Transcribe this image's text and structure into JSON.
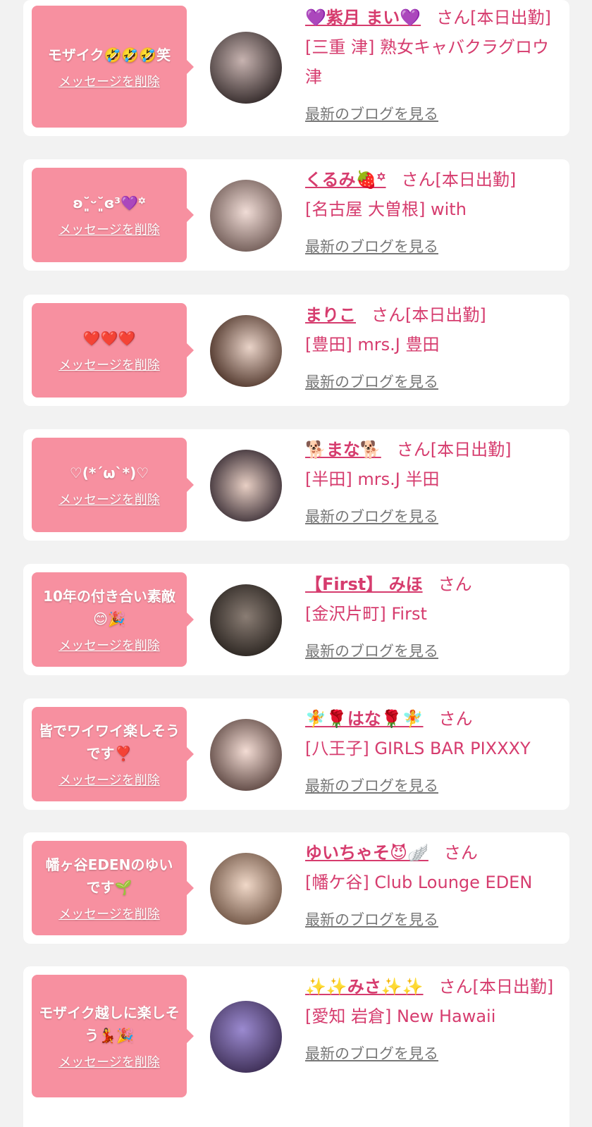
{
  "common": {
    "delete_label": "メッセージを削除",
    "blog_label": "最新のブログを見る"
  },
  "cards": [
    {
      "message": "モザイク🤣🤣🤣笑",
      "name": "💜紫月 まい💜",
      "suffix": "さん[本日出勤]",
      "shop": "[三重 津] 熟女キャバクラグロウ津"
    },
    {
      "message": "ʚ˘͈ᵕ˘͈ɞ³💜꙳",
      "name": "くるみ🍓꙳",
      "suffix": "さん[本日出勤]",
      "shop": "[名古屋 大曽根] with"
    },
    {
      "message": "❤️❤️❤️",
      "name": "まりこ",
      "suffix": "さん[本日出勤]",
      "shop": "[豊田] mrs.J 豊田"
    },
    {
      "message": "♡(*´ω`*)♡",
      "name": "🐕まな🐕",
      "suffix": "さん[本日出勤]",
      "shop": "[半田] mrs.J 半田"
    },
    {
      "message": "10年の付き合い素敵😊🎉",
      "name": "【First】 みほ",
      "suffix": "さん",
      "shop": "[金沢片町] First"
    },
    {
      "message": "皆でワイワイ楽しそうです❣️",
      "name": "🧚🌹はな🌹🧚",
      "suffix": "さん",
      "shop": "[八王子] GIRLS BAR PIXXXY"
    },
    {
      "message": "幡ヶ谷EDENのゆいです🌱",
      "name": "ゆいちゃそ😈🪽",
      "suffix": "さん",
      "shop": "[幡ケ谷] Club Lounge EDEN"
    },
    {
      "message": "モザイク越しに楽しそう💃🎉",
      "name": "✨✨みさ✨✨",
      "suffix": "さん[本日出勤]",
      "shop": "[愛知 岩倉] New Hawaii"
    }
  ],
  "colors": {
    "accent": "#d63c6e",
    "bubble": "#f790a0",
    "background": "#f2f2f2"
  }
}
